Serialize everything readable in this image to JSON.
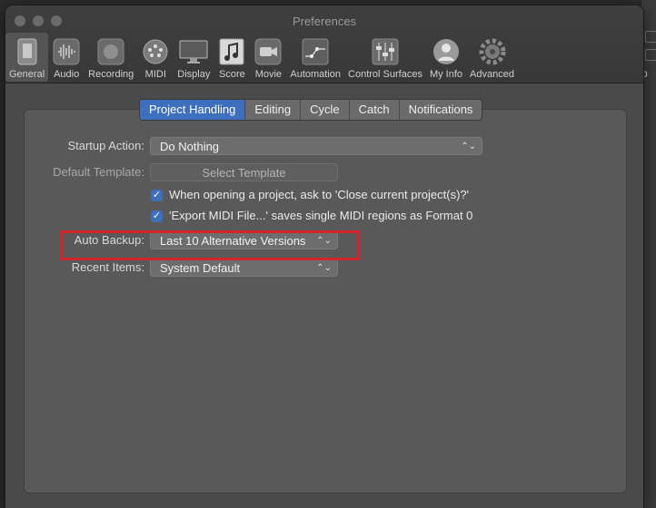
{
  "window": {
    "title": "Preferences"
  },
  "toolbar": {
    "items": [
      {
        "label": "General",
        "icon": "general-icon"
      },
      {
        "label": "Audio",
        "icon": "audio-icon"
      },
      {
        "label": "Recording",
        "icon": "recording-icon"
      },
      {
        "label": "MIDI",
        "icon": "midi-icon"
      },
      {
        "label": "Display",
        "icon": "display-icon"
      },
      {
        "label": "Score",
        "icon": "score-icon"
      },
      {
        "label": "Movie",
        "icon": "movie-icon"
      },
      {
        "label": "Automation",
        "icon": "automation-icon"
      },
      {
        "label": "Control Surfaces",
        "icon": "control-surfaces-icon"
      },
      {
        "label": "My Info",
        "icon": "my-info-icon"
      },
      {
        "label": "Advanced",
        "icon": "advanced-icon"
      }
    ]
  },
  "tabs": [
    "Project Handling",
    "Editing",
    "Cycle",
    "Catch",
    "Notifications"
  ],
  "form": {
    "startup_action_label": "Startup Action:",
    "startup_action_value": "Do Nothing",
    "default_template_label": "Default Template:",
    "select_template_button": "Select Template",
    "check_close_project": "When opening a project, ask to 'Close current project(s)?'",
    "check_export_midi": "'Export MIDI File...' saves single MIDI regions as Format 0",
    "auto_backup_label": "Auto Backup:",
    "auto_backup_value": "Last 10 Alternative Versions",
    "recent_items_label": "Recent Items:",
    "recent_items_value": "System Default"
  },
  "background": {
    "right_fragment": "p"
  },
  "colors": {
    "accent": "#3e6fbf",
    "highlight": "#d3242b"
  }
}
